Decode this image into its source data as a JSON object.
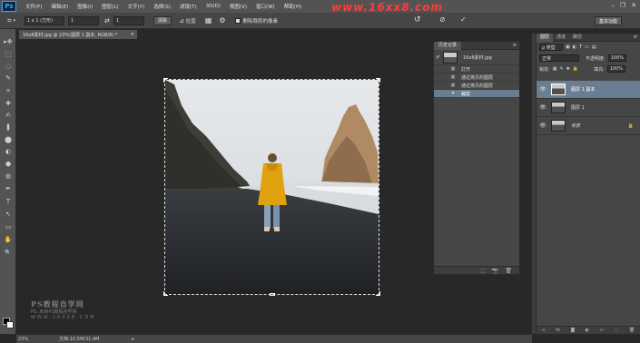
{
  "app": {
    "logo": "Ps"
  },
  "menu": [
    "文件(F)",
    "编辑(E)",
    "图像(I)",
    "图层(L)",
    "文字(Y)",
    "选择(S)",
    "滤镜(T)",
    "3D(D)",
    "视图(V)",
    "窗口(W)",
    "帮助(H)"
  ],
  "watermark_url": "www.16xx8.com",
  "window_controls": {
    "minimize": "–",
    "restore": "❐",
    "close": "✕"
  },
  "options": {
    "crop_icon": "crop-tool-icon",
    "ratio_select": "1 x 1 (方形)",
    "width_value": "1",
    "swap": "⇄",
    "height_value": "1",
    "clear_label": "清除",
    "straighten_label": "拉直",
    "delete_cropped_label": "删除裁剪的像素",
    "workspace_label": "基本功能"
  },
  "doc_tab": {
    "title": "16x8素材.jpg @ 23%(图层 1 副本, RGB/8) *",
    "close": "×"
  },
  "tools": [
    "▸✥",
    "⬚",
    "◌",
    "✎",
    "⌗",
    "✚",
    "✍",
    "❚",
    "⬤",
    "◐",
    "⬢",
    "◍",
    "✒",
    "T",
    "↖",
    "▭",
    "✋",
    "🔍"
  ],
  "site_mark": {
    "line1": "PS教程自学网",
    "line2": "PS, 就到PS教程自学网",
    "line3": "WWW.16XX8.COM"
  },
  "status": {
    "zoom": "23%",
    "doc_size": "文档:10.5M/31.4M",
    "arrow": "▸"
  },
  "history": {
    "tab": "历史记录",
    "snapshot_name": "16x8素材.jpg",
    "items": [
      {
        "label": "打开",
        "icon": "▦",
        "selected": false
      },
      {
        "label": "通过拷贝的图层",
        "icon": "▦",
        "selected": false
      },
      {
        "label": "通过拷贝的图层",
        "icon": "▦",
        "selected": false
      },
      {
        "label": "裁剪",
        "icon": "⌗",
        "selected": true
      }
    ],
    "bottom_icons": [
      "⬚",
      "📷",
      "🗑"
    ]
  },
  "layers": {
    "tabs": [
      "图层",
      "通道",
      "路径"
    ],
    "kind_label": "ρ 类型",
    "blend_mode": "正常",
    "opacity_label": "不透明度:",
    "opacity_value": "100%",
    "lock_label": "锁定:",
    "fill_label": "填充:",
    "fill_value": "100%",
    "items": [
      {
        "name": "图层 1 副本",
        "selected": true,
        "locked": false
      },
      {
        "name": "图层 1",
        "selected": false,
        "locked": false
      },
      {
        "name": "背景",
        "selected": false,
        "locked": true
      }
    ],
    "bottom_icons": [
      "∞",
      "fx",
      "◙",
      "◐",
      "▭",
      "⬚",
      "🗑"
    ]
  }
}
